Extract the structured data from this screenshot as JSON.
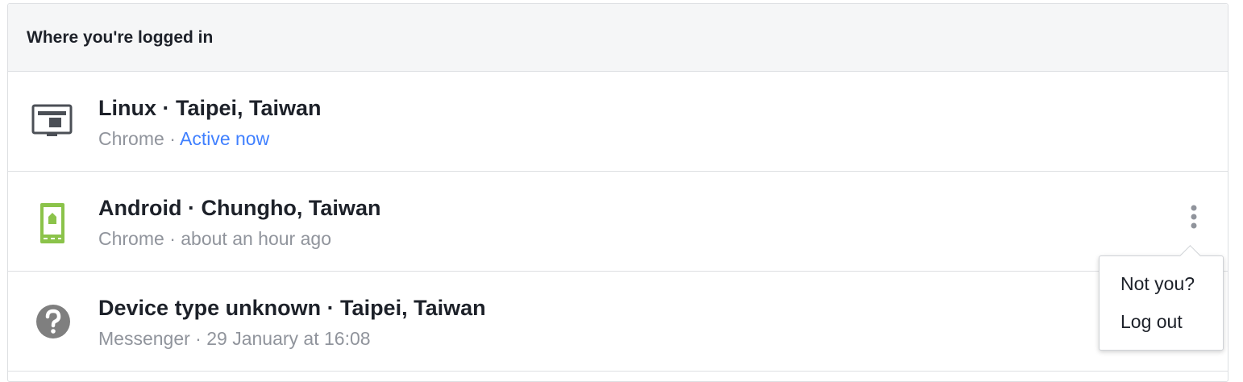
{
  "header": {
    "title": "Where you're logged in"
  },
  "sessions": [
    {
      "title": "Linux · Taipei, Taiwan",
      "app": "Chrome",
      "separator": " · ",
      "status": "Active now",
      "icon": "desktop-icon"
    },
    {
      "title": "Android · Chungho, Taiwan",
      "app": "Chrome",
      "separator": " · ",
      "status": "about an hour ago",
      "icon": "android-phone-icon"
    },
    {
      "title": "Device type unknown · Taipei, Taiwan",
      "app": "Messenger",
      "separator": " · ",
      "status": "29 January at 16:08",
      "icon": "question-mark-icon"
    }
  ],
  "menu": {
    "not_you": "Not you?",
    "log_out": "Log out"
  },
  "colors": {
    "header_bg": "#f5f6f7",
    "border": "#dddfe2",
    "active_link": "#4080ff",
    "muted_text": "#90949c",
    "android_green": "#8bc34a"
  }
}
